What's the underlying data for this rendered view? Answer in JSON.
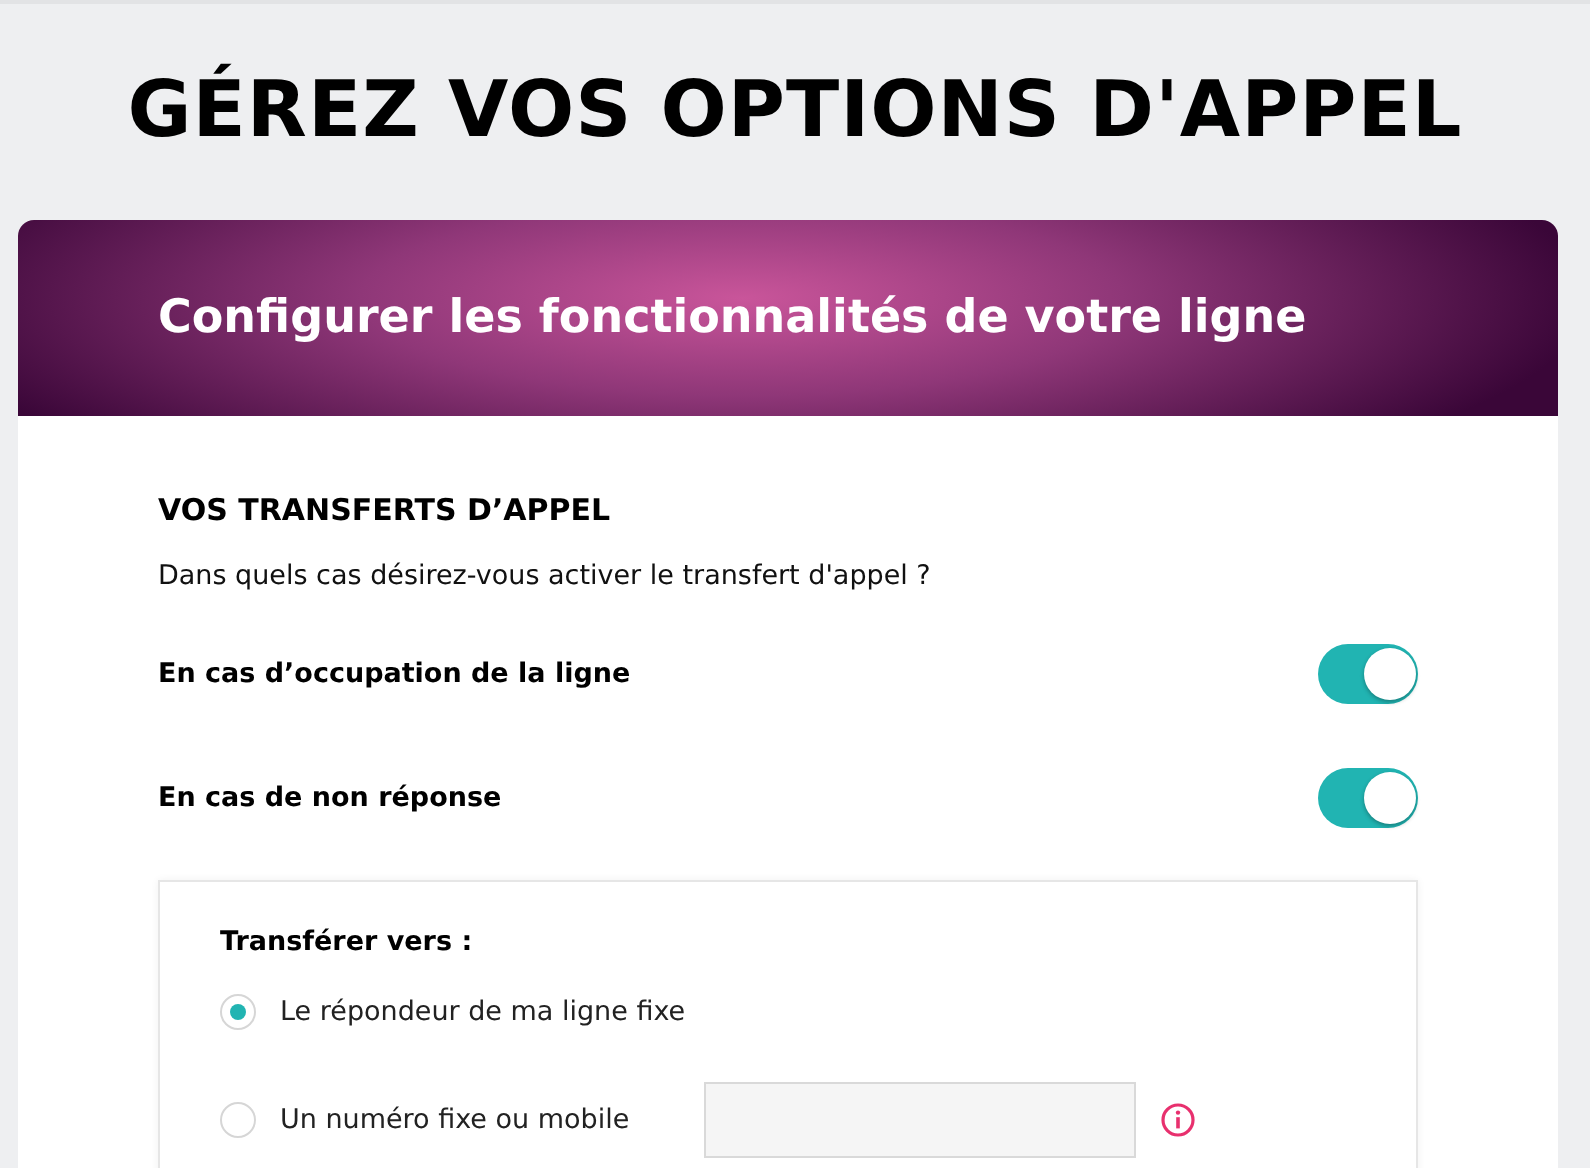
{
  "page_title": "GÉREZ VOS OPTIONS D'APPEL",
  "card": {
    "title": "Configurer les fonctionnalités de votre ligne",
    "section_heading": "VOS TRANSFERTS D’APPEL",
    "question": "Dans quels cas désirez-vous activer le transfert d'appel ?",
    "toggles": [
      {
        "label": "En cas d’occupation de la ligne",
        "on": true
      },
      {
        "label": "En cas de non réponse",
        "on": true
      }
    ],
    "transfer": {
      "label": "Transférer vers :",
      "options": [
        {
          "label": "Le répondeur de ma ligne fixe",
          "selected": true,
          "kind": "plain"
        },
        {
          "label": "Un numéro fixe ou mobile",
          "selected": false,
          "kind": "number"
        }
      ]
    }
  }
}
